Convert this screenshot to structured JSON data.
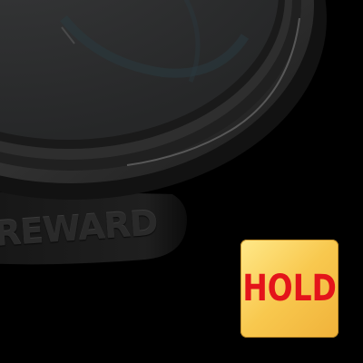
{
  "reward_wheel": {
    "label": "REWARD"
  },
  "hold_button": {
    "label": "HOLD"
  },
  "colors": {
    "background": "#000000",
    "button_gold": "#f8c84e",
    "button_text_red": "#e4141a"
  }
}
